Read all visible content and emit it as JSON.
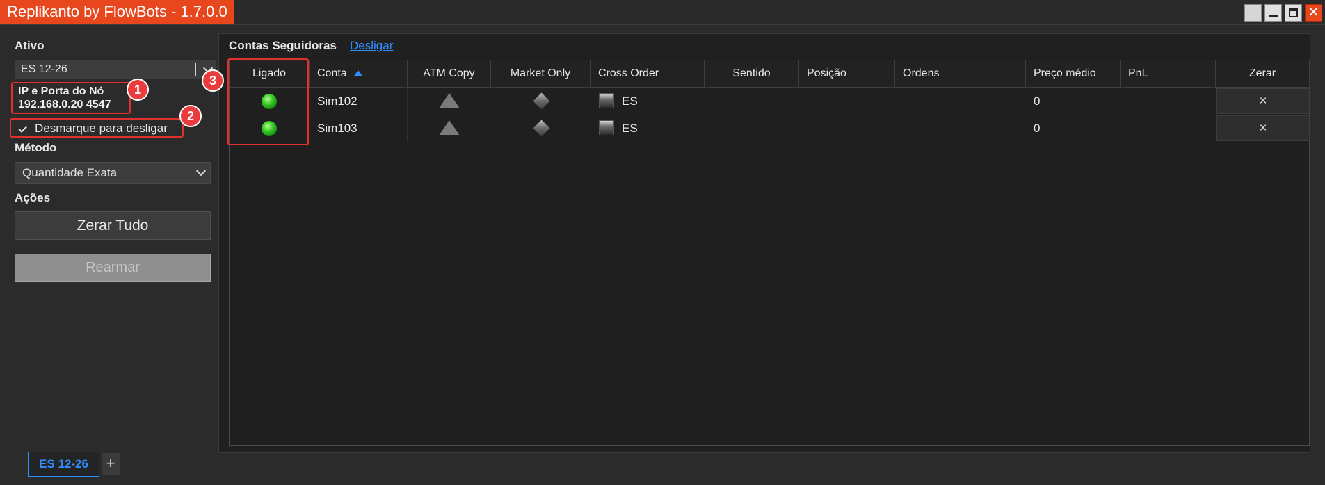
{
  "window": {
    "title": "Replikanto by FlowBots - 1.7.0.0",
    "close_glyph": "✕"
  },
  "left_panel": {
    "ativo_label": "Ativo",
    "ativo_value": "ES 12-26",
    "ip_label": "IP e Porta do Nó",
    "ip_value": "192.168.0.20  4547",
    "checkbox_label": "Desmarque para desligar",
    "checkbox_checked": true,
    "metodo_label": "Método",
    "metodo_value": "Quantidade Exata",
    "acoes_label": "Ações",
    "zerar_tudo_label": "Zerar Tudo",
    "rearmar_label": "Rearmar"
  },
  "annotations": {
    "badge1": "1",
    "badge2": "2",
    "badge3": "3"
  },
  "right_panel": {
    "title": "Contas Seguidoras",
    "link": "Desligar",
    "columns": [
      "Ligado",
      "Conta",
      "ATM Copy",
      "Market Only",
      "Cross Order",
      "Sentido",
      "Posição",
      "Ordens",
      "Preço médio",
      "PnL",
      "Zerar"
    ],
    "rows": [
      {
        "conta": "Sim102",
        "cross_order": "ES",
        "preco_medio": "0",
        "zerar": "×",
        "ligado": "green-led-icon"
      },
      {
        "conta": "Sim103",
        "cross_order": "ES",
        "preco_medio": "0",
        "zerar": "×",
        "ligado": "green-led-icon"
      }
    ]
  },
  "tabs": {
    "active": "ES 12-26",
    "add": "+"
  },
  "colors": {
    "accent": "#e8461c",
    "link": "#2f8fff",
    "highlight": "#e03030"
  }
}
